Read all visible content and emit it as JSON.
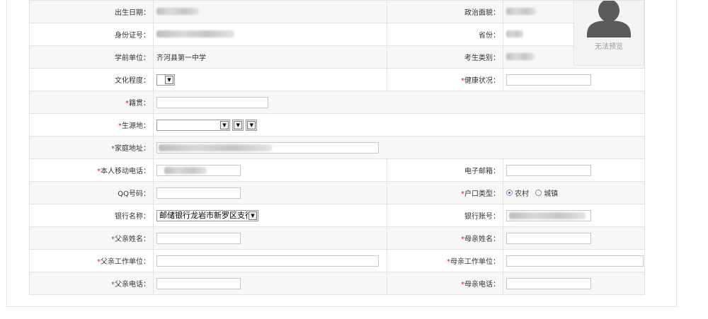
{
  "photo": {
    "caption": "无法预览"
  },
  "rows": {
    "birth_date": {
      "label": "出生日期："
    },
    "political_status": {
      "label": "政治面貌："
    },
    "id_number": {
      "label": "身份证号："
    },
    "province": {
      "label": "省份："
    },
    "previous_school": {
      "label": "学前单位：",
      "value": "齐河县第一中学"
    },
    "candidate_type": {
      "label": "考生类别："
    },
    "education_level": {
      "label": "文化程度：",
      "value": ""
    },
    "health_status": {
      "label": "健康状况：",
      "value": ""
    },
    "native_place": {
      "label": "籍贯：",
      "value": ""
    },
    "origin_place": {
      "label": "生源地："
    },
    "home_address": {
      "label": "家庭地址："
    },
    "mobile_phone": {
      "label": "本人移动电话："
    },
    "email": {
      "label": "电子邮箱：",
      "value": ""
    },
    "qq_number": {
      "label": "QQ号码：",
      "value": ""
    },
    "hukou_type": {
      "label": "户口类型：",
      "options": [
        "农村",
        "城镇"
      ],
      "selected": "农村"
    },
    "bank_name": {
      "label": "银行名称：",
      "value": "邮储银行龙岩市新罗区支行"
    },
    "bank_account": {
      "label": "银行账号："
    },
    "father_name": {
      "label": "父亲姓名：",
      "value": ""
    },
    "mother_name": {
      "label": "母亲姓名：",
      "value": ""
    },
    "father_work": {
      "label": "父亲工作单位：",
      "value": ""
    },
    "mother_work": {
      "label": "母亲工作单位：",
      "value": ""
    },
    "father_phone": {
      "label": "父亲电话：",
      "value": ""
    },
    "mother_phone": {
      "label": "母亲电话：",
      "value": ""
    }
  },
  "required_mark": "*",
  "colors": {
    "required": "#e02020",
    "border": "#e3e3e3",
    "alt_row": "#f7f7f7",
    "radio_dot": "#2b6cd6"
  }
}
